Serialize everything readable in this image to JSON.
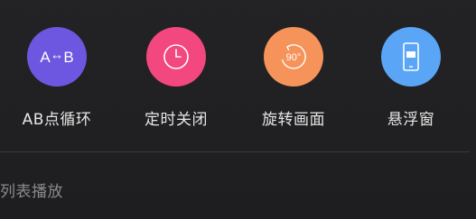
{
  "actions": [
    {
      "icon": "ab-repeat-icon",
      "icon_text_a": "A",
      "icon_text_b": "B",
      "label": "AB点循环",
      "color": "#6d57e0"
    },
    {
      "icon": "timer-icon",
      "label": "定时关闭",
      "color": "#f2477f"
    },
    {
      "icon": "rotate-icon",
      "icon_text": "90°",
      "label": "旋转画面",
      "color": "#f5935a"
    },
    {
      "icon": "floating-window-icon",
      "label": "悬浮窗",
      "color": "#5aa5f6"
    }
  ],
  "playlist": {
    "title": "列表播放"
  }
}
